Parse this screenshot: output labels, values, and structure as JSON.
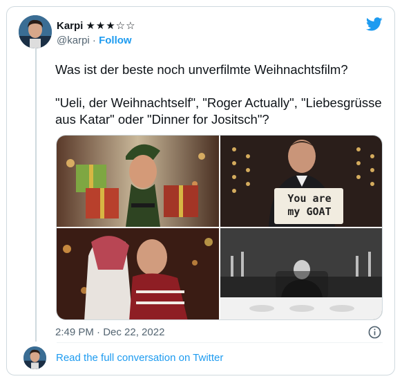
{
  "author": {
    "name": "Karpi",
    "rating": "★★★☆☆",
    "handle": "@karpi",
    "separator": "·",
    "follow_label": "Follow"
  },
  "tweet": {
    "paragraphs": [
      "Was ist der beste noch unverfilmte Weihnachtsfilm?",
      "\"Ueli, der Weihnachtself\", \"Roger Actually\", \"Liebesgrüsse aus Katar\" oder \"Dinner for Jositsch\"?"
    ],
    "timestamp": "2:49 PM · Dec 22, 2022"
  },
  "media": {
    "sign_text_line1": "You are",
    "sign_text_line2": "my GOAT"
  },
  "footer": {
    "read_more": "Read the full conversation on Twitter"
  },
  "icons": [
    "twitter-bird-icon",
    "info-icon",
    "star-icon"
  ],
  "colors": {
    "accent": "#1d9bf0",
    "muted": "#536471",
    "border": "#cfd9de"
  }
}
